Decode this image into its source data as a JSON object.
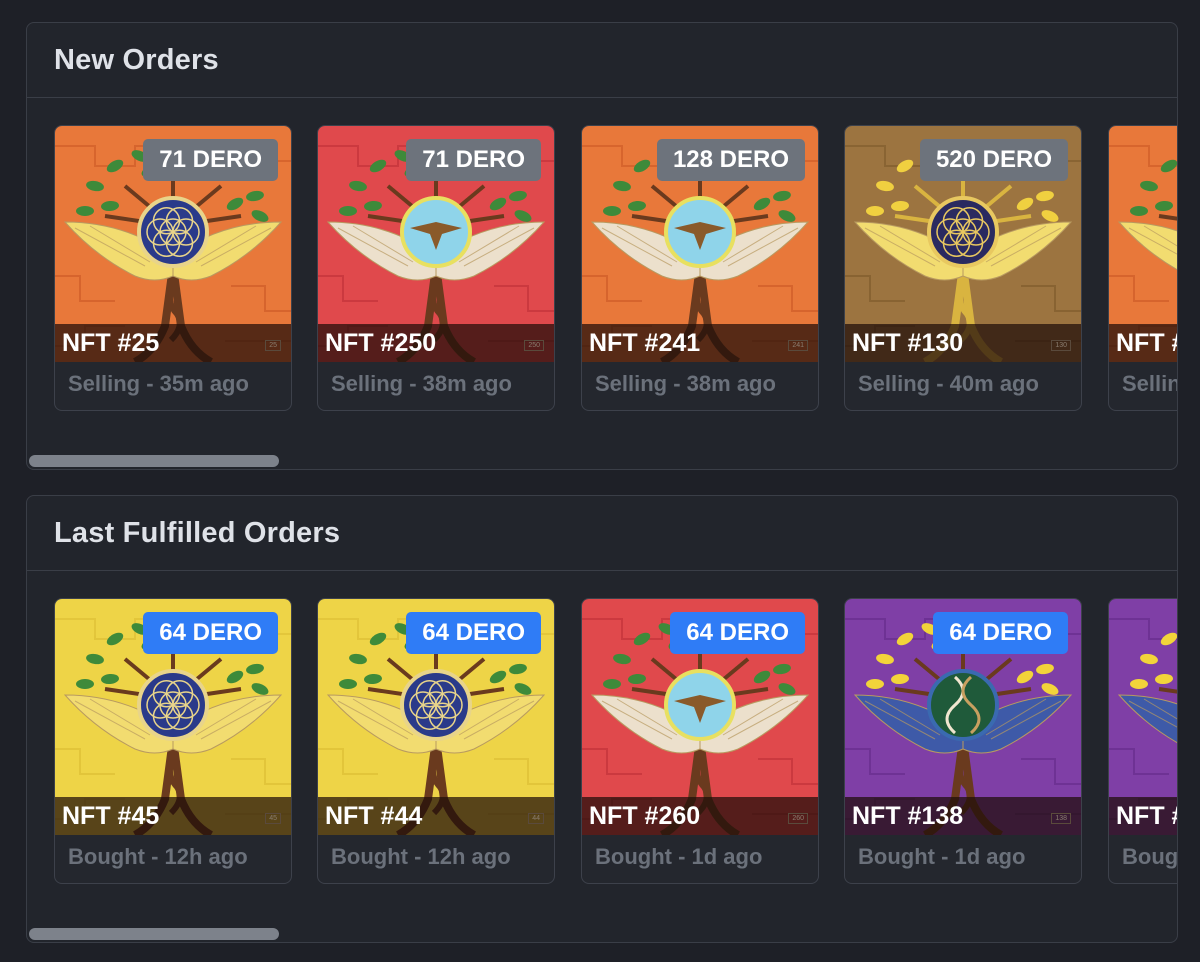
{
  "sections": [
    {
      "title": "New Orders",
      "cards": [
        {
          "price": "71 DERO",
          "name": "NFT #25",
          "tag": "25",
          "status": "Selling - 35m ago",
          "bg": "#e8783a",
          "bg2": "#d2602a",
          "emblem": "seed"
        },
        {
          "price": "71 DERO",
          "name": "NFT #250",
          "tag": "250",
          "status": "Selling - 38m ago",
          "bg": "#e0494c",
          "bg2": "#c7363c",
          "emblem": "eagle"
        },
        {
          "price": "128 DERO",
          "name": "NFT #241",
          "tag": "241",
          "status": "Selling - 38m ago",
          "bg": "#e8783a",
          "bg2": "#d2602a",
          "emblem": "eagle"
        },
        {
          "price": "520 DERO",
          "name": "NFT #130",
          "tag": "130",
          "status": "Selling - 40m ago",
          "bg": "#9c7440",
          "bg2": "#84602f",
          "emblem": "gold"
        },
        {
          "price": "",
          "name": "NFT #",
          "tag": "",
          "status": "Selling",
          "bg": "#e8783a",
          "bg2": "#d2602a",
          "emblem": "seed"
        }
      ]
    },
    {
      "title": "Last Fulfilled Orders",
      "cards": [
        {
          "price": "64 DERO",
          "name": "NFT #45",
          "tag": "45",
          "status": "Bought - 12h ago",
          "bg": "#eed447",
          "bg2": "#e0c238",
          "emblem": "flower"
        },
        {
          "price": "64 DERO",
          "name": "NFT #44",
          "tag": "44",
          "status": "Bought - 12h ago",
          "bg": "#eed447",
          "bg2": "#e0c238",
          "emblem": "flower"
        },
        {
          "price": "64 DERO",
          "name": "NFT #260",
          "tag": "260",
          "status": "Bought - 1d ago",
          "bg": "#e0494c",
          "bg2": "#c7363c",
          "emblem": "eagle"
        },
        {
          "price": "64 DERO",
          "name": "NFT #138",
          "tag": "138",
          "status": "Bought - 1d ago",
          "bg": "#7f3fa6",
          "bg2": "#6a2f90",
          "emblem": "dna"
        },
        {
          "price": "",
          "name": "NFT #",
          "tag": "",
          "status": "Boug",
          "bg": "#7f3fa6",
          "bg2": "#6a2f90",
          "emblem": "dna"
        }
      ]
    }
  ],
  "colors": {
    "page_bg": "#1e2027",
    "panel_bg": "#22252c",
    "price_gray": "#6d737c",
    "price_blue": "#2f7cf6"
  }
}
